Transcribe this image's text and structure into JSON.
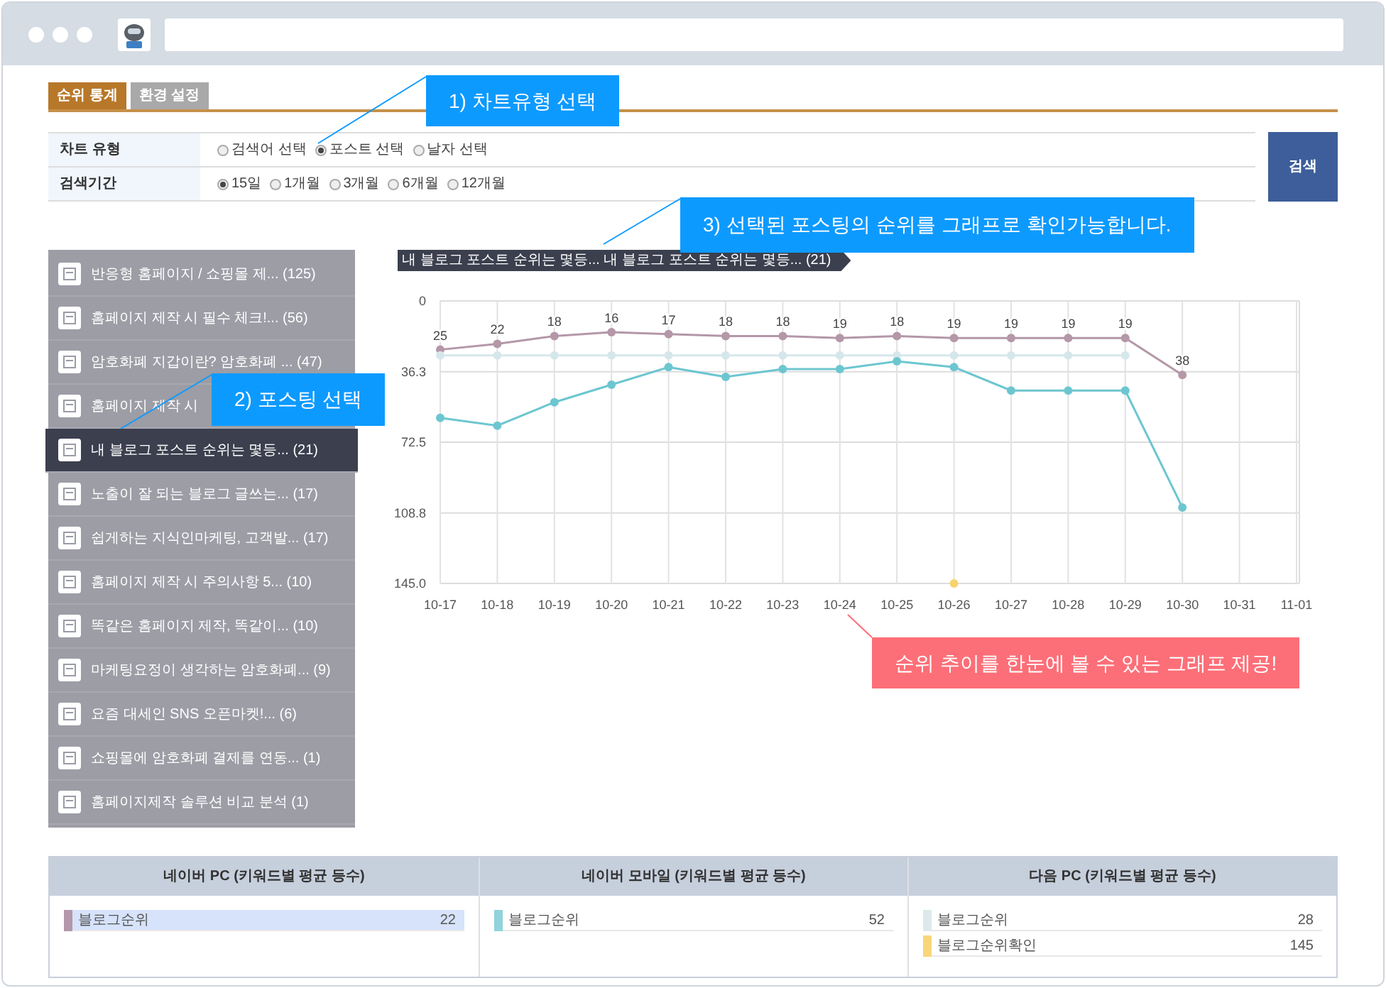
{
  "tabs": [
    {
      "label": "순위 통계",
      "selected": true
    },
    {
      "label": "환경 설정",
      "selected": false
    }
  ],
  "filters": [
    {
      "label": "차트 유형",
      "options": [
        {
          "label": "검색어 선택",
          "selected": false
        },
        {
          "label": "포스트 선택",
          "selected": true
        },
        {
          "label": "날자 선택",
          "selected": false
        }
      ]
    },
    {
      "label": "검색기간",
      "options": [
        {
          "label": "15일",
          "selected": true
        },
        {
          "label": "1개월",
          "selected": false
        },
        {
          "label": "3개월",
          "selected": false
        },
        {
          "label": "6개월",
          "selected": false
        },
        {
          "label": "12개월",
          "selected": false
        }
      ]
    }
  ],
  "search_button": "검색",
  "posts": [
    {
      "label": "반응형 홈페이지 / 쇼핑몰 제... (125)",
      "selected": false
    },
    {
      "label": "홈페이지 제작 시 필수 체크!... (56)",
      "selected": false
    },
    {
      "label": "암호화폐 지갑이란? 암호화폐 ... (47)",
      "selected": false
    },
    {
      "label": "홈페이지 제작 시",
      "selected": false
    },
    {
      "label": "내 블로그 포스트 순위는 몇등... (21)",
      "selected": true
    },
    {
      "label": "노출이 잘 되는 블로그 글쓰는... (17)",
      "selected": false
    },
    {
      "label": "쉽게하는 지식인마케팅, 고객발... (17)",
      "selected": false
    },
    {
      "label": "홈페이지 제작 시 주의사항 5... (10)",
      "selected": false
    },
    {
      "label": "똑같은 홈페이지 제작, 똑같이... (10)",
      "selected": false
    },
    {
      "label": "마케팅요정이 생각하는 암호화폐... (9)",
      "selected": false
    },
    {
      "label": "요즘 대세인 SNS 오픈마켓!... (6)",
      "selected": false
    },
    {
      "label": "쇼핑몰에 암호화폐 결제를 연동... (1)",
      "selected": false
    },
    {
      "label": "홈페이지제작 솔루션 비교 분석 (1)",
      "selected": false
    }
  ],
  "chart": {
    "tag": "내 블로그 포스트 순위는 몇등... 내 블로그 포스트 순위는 몇등... (21)",
    "chart_data": {
      "type": "line",
      "categories": [
        "10-17",
        "10-18",
        "10-19",
        "10-20",
        "10-21",
        "10-22",
        "10-23",
        "10-24",
        "10-25",
        "10-26",
        "10-27",
        "10-28",
        "10-29",
        "10-30",
        "10-31",
        "11-01"
      ],
      "ylim": [
        145,
        0
      ],
      "yticks": [
        {
          "value": 0,
          "label": "0"
        },
        {
          "value": 36.3,
          "label": "36.3"
        },
        {
          "value": 72.5,
          "label": "72.5"
        },
        {
          "value": 108.8,
          "label": "108.8"
        },
        {
          "value": 145,
          "label": "145.0"
        }
      ],
      "series": [
        {
          "color": "#b497a8",
          "marker": "circle",
          "data_labels": true,
          "values": [
            25,
            22,
            18,
            16,
            17,
            18,
            18,
            19,
            18,
            19,
            19,
            19,
            19,
            38,
            null,
            null
          ]
        },
        {
          "color": "#d6e7ec",
          "marker": "circle",
          "data_labels": false,
          "values": [
            28,
            28,
            28,
            28,
            28,
            28,
            28,
            28,
            28,
            28,
            28,
            28,
            28,
            null,
            null,
            null
          ]
        },
        {
          "color": "#6cc6d0",
          "marker": "circle",
          "data_labels": false,
          "values": [
            60,
            64,
            52,
            43,
            34,
            39,
            35,
            35,
            31,
            34,
            46,
            46,
            46,
            106,
            null,
            null
          ]
        },
        {
          "color": "#f7d36b",
          "marker": "circle",
          "data_labels": false,
          "values": [
            null,
            null,
            null,
            null,
            null,
            null,
            null,
            null,
            null,
            145,
            null,
            null,
            null,
            null,
            null,
            null
          ]
        }
      ]
    }
  },
  "summary": [
    {
      "title": "네이버 PC (키워드별 평균 등수)",
      "rows": [
        {
          "label": "블로그순위",
          "value": "22",
          "color": "#b497a8",
          "selected": true
        }
      ]
    },
    {
      "title": "네이버 모바일 (키워드별 평균 등수)",
      "rows": [
        {
          "label": "블로그순위",
          "value": "52",
          "color": "#8fd3dc",
          "selected": false
        }
      ]
    },
    {
      "title": "다음 PC (키워드별 평균 등수)",
      "rows": [
        {
          "label": "블로그순위",
          "value": "28",
          "color": "#dce9ec",
          "selected": false
        },
        {
          "label": "블로그순위확인",
          "value": "145",
          "color": "#f8d67a",
          "selected": false
        }
      ]
    }
  ],
  "callouts": [
    {
      "text": "1) 차트유형 선택",
      "kind": "info"
    },
    {
      "text": "3) 선택된 포스팅의 순위를 그래프로 확인가능합니다.",
      "kind": "info"
    },
    {
      "text": "2) 포스팅 선택",
      "kind": "info"
    },
    {
      "text": "순위 추이를 한눈에 볼 수 있는 그래프 제공!",
      "kind": "highlight"
    }
  ]
}
